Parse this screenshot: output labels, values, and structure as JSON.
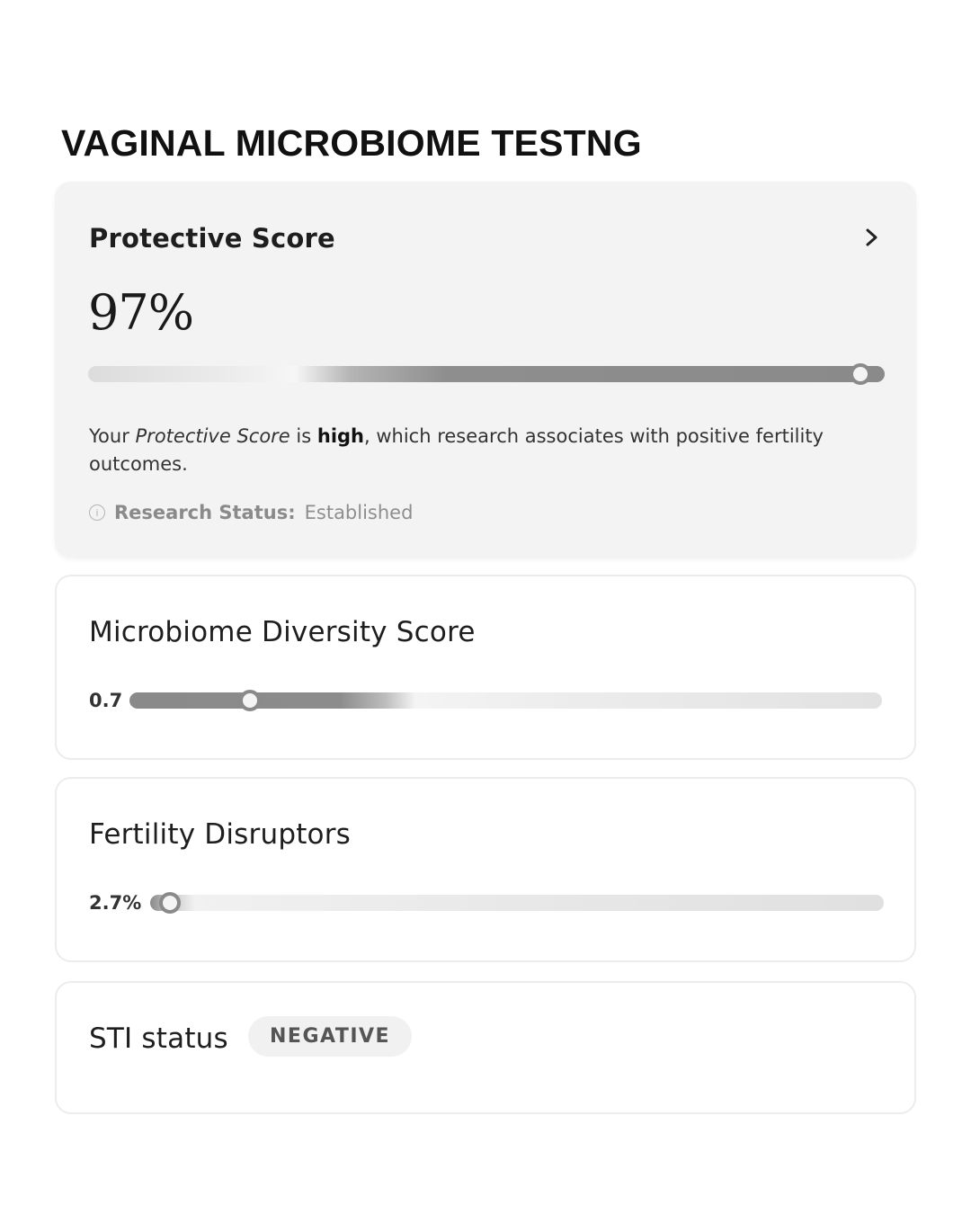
{
  "page": {
    "title": "VAGINAL MICROBIOME TESTNG"
  },
  "protective_score": {
    "title": "Protective Score",
    "value": "97%",
    "level": 0.97,
    "description": {
      "prefix": "Your ",
      "term": "Protective Score",
      "middle": " is ",
      "emphasis": "high",
      "suffix": ", which research associates with positive fertility outcomes."
    },
    "research_status_label": "Research Status:",
    "research_status_value": "Established",
    "icons": {
      "open": "chevron-right-icon",
      "info": "info-icon"
    }
  },
  "diversity_score": {
    "title": "Microbiome Diversity Score",
    "value": "0.7",
    "level": 0.16
  },
  "fertility_disruptors": {
    "title": "Fertility Disruptors",
    "value": "2.7%",
    "level": 0.027
  },
  "sti_status": {
    "title": "STI status",
    "badge": "NEGATIVE"
  },
  "colors": {
    "track_dark": "#8a8a8a",
    "track_light": "#e6e6e6",
    "card_featured_bg": "#f3f3f3"
  }
}
